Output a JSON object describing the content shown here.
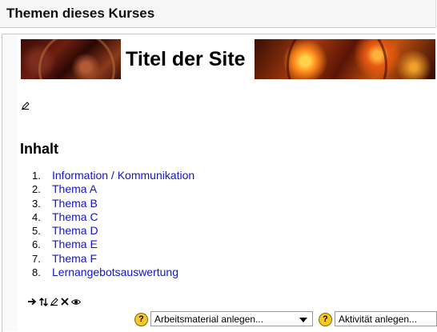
{
  "header": {
    "title": "Themen dieses Kurses"
  },
  "banner": {
    "title": "Titel der Site"
  },
  "section": {
    "heading": "Inhalt"
  },
  "toc": [
    {
      "num": "1.",
      "label": "Information / Kommunikation"
    },
    {
      "num": "2.",
      "label": "Thema A"
    },
    {
      "num": "3.",
      "label": "Thema B"
    },
    {
      "num": "4.",
      "label": "Thema C"
    },
    {
      "num": "5.",
      "label": "Thema D"
    },
    {
      "num": "6.",
      "label": "Thema E"
    },
    {
      "num": "7.",
      "label": "Thema F"
    },
    {
      "num": "8.",
      "label": "Lernangebotsauswertung"
    }
  ],
  "toolbar": {
    "icons": [
      "move-right-icon",
      "move-updown-icon",
      "edit-icon",
      "delete-icon",
      "visibility-eye-icon"
    ]
  },
  "bottom": {
    "help_glyph": "?",
    "resource_select": "Arbeitsmaterial anlegen...",
    "activity_select": "Aktivität anlegen..."
  },
  "colors": {
    "link": "#1414c8",
    "help_icon": "#f7c72a"
  }
}
